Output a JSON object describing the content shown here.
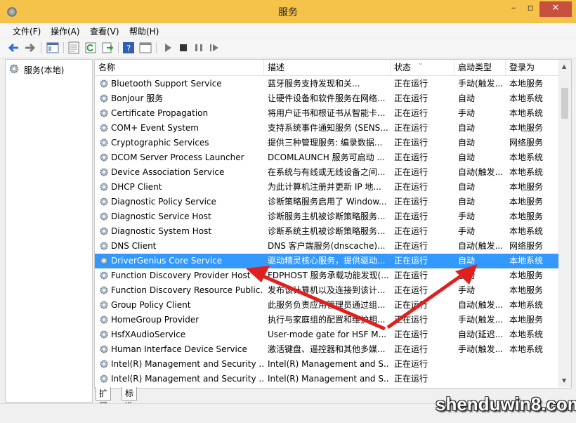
{
  "window": {
    "title": "服务"
  },
  "menu": [
    "文件(F)",
    "操作(A)",
    "查看(V)",
    "帮助(H)"
  ],
  "tree": {
    "root_label": "服务(本地)"
  },
  "columns": {
    "name": "名称",
    "description": "描述",
    "status": "状态",
    "startup": "启动类型",
    "logon": "登录为"
  },
  "services": [
    [
      "Bluetooth Support Service",
      "蓝牙服务支持发现和关...",
      "正在运行",
      "手动(触发...",
      "本地服务"
    ],
    [
      "Bonjour 服务",
      "让硬件设备和软件服务在网络...",
      "正在运行",
      "自动",
      "本地系统"
    ],
    [
      "Certificate Propagation",
      "将用户证书和根证书从智能卡...",
      "正在运行",
      "手动",
      "本地系统"
    ],
    [
      "COM+ Event System",
      "支持系统事件通知服务 (SENS...",
      "正在运行",
      "自动",
      "本地服务"
    ],
    [
      "Cryptographic Services",
      "提供三种管理服务: 编录数据...",
      "正在运行",
      "自动",
      "网络服务"
    ],
    [
      "DCOM Server Process Launcher",
      "DCOMLAUNCH 服务可启动 ...",
      "正在运行",
      "自动",
      "本地系统"
    ],
    [
      "Device Association Service",
      "在系统与有线或无线设备之间...",
      "正在运行",
      "自动(触发...",
      "本地系统"
    ],
    [
      "DHCP Client",
      "为此计算机注册并更新 IP 地...",
      "正在运行",
      "自动",
      "本地服务"
    ],
    [
      "Diagnostic Policy Service",
      "诊断策略服务启用了 Window...",
      "正在运行",
      "自动",
      "本地服务"
    ],
    [
      "Diagnostic Service Host",
      "诊断服务主机被诊断策略服务...",
      "正在运行",
      "手动",
      "本地服务"
    ],
    [
      "Diagnostic System Host",
      "诊断系统主机被诊断策略服务...",
      "正在运行",
      "手动",
      "本地系统"
    ],
    [
      "DNS Client",
      "DNS 客户端服务(dnscache)...",
      "正在运行",
      "自动(触发...",
      "网络服务"
    ],
    [
      "DriverGenius Core Service",
      "驱动精灵核心服务，提供驱动...",
      "正在运行",
      "自动",
      "本地系统"
    ],
    [
      "Function Discovery Provider Host",
      "FDPHOST 服务承载功能发现(...",
      "正在运行",
      "手动",
      "本地服务"
    ],
    [
      "Function Discovery Resource Public...",
      "发布该计算机以及连接到该计...",
      "正在运行",
      "手动",
      "本地服务"
    ],
    [
      "Group Policy Client",
      "此服务负责应用管理员通过组...",
      "正在运行",
      "自动(触发...",
      "本地系统"
    ],
    [
      "HomeGroup Provider",
      "执行与家庭组的配置和维护相...",
      "正在运行",
      "手动(触发...",
      "本地服务"
    ],
    [
      "HsfXAudioService",
      "User-mode gate for HSF M...",
      "正在运行",
      "自动(延迟...",
      "本地系统"
    ],
    [
      "Human Interface Device Service",
      "激活键盘、遥控器和其他多媒...",
      "正在运行",
      "手动(触发...",
      "本地系统"
    ],
    [
      "Intel(R) Management and Security ...",
      "Intel(R) Management and S...",
      "正在运行",
      "",
      ""
    ],
    [
      "Intel(R) Management and Security ...",
      "Intel(R) Management and S...",
      "正在运行",
      "",
      ""
    ]
  ],
  "selected_row": 12,
  "tabs": [
    "扩展",
    "标准"
  ],
  "watermark": "shenduwin8.com",
  "colors": {
    "titlebar": "#f5c24a",
    "selection": "#3399ff",
    "close": "#c7503f",
    "arrow": "#e02020"
  }
}
